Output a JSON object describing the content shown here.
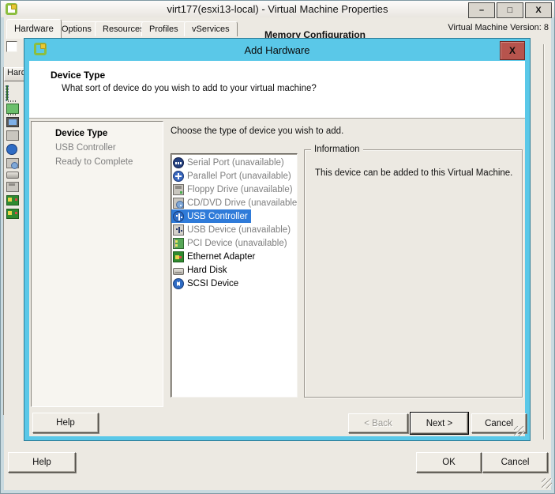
{
  "window": {
    "title": "virt177(esxi13-local) - Virtual Machine Properties",
    "controls": {
      "minimize": "–",
      "maximize": "□",
      "close": "X"
    },
    "tabs": [
      {
        "label": "Hardware",
        "active": true
      },
      {
        "label": "Options",
        "active": false
      },
      {
        "label": "Resources",
        "active": false
      },
      {
        "label": "Profiles",
        "active": false
      },
      {
        "label": "vServices",
        "active": false
      }
    ],
    "version_label": "Virtual Machine Version: 8",
    "clipped_heading": "Memory Configuration",
    "hardware_panel_header": "Hardware",
    "hardware_icons": [
      "memory",
      "cpu",
      "video-card",
      "vmci-device",
      "scsi-controller",
      "cd-dvd-drive",
      "hard-disk",
      "floppy-drive",
      "network-adapter-1",
      "network-adapter-2"
    ],
    "buttons": {
      "help": "Help",
      "ok": "OK",
      "cancel": "Cancel"
    }
  },
  "wizard": {
    "title": "Add Hardware",
    "close_label": "X",
    "header": {
      "title": "Device Type",
      "subtitle": "What sort of device do you wish to add to your virtual machine?"
    },
    "steps": [
      {
        "label": "Device Type",
        "state": "current"
      },
      {
        "label": "USB Controller",
        "state": "upcoming"
      },
      {
        "label": "Ready to Complete",
        "state": "upcoming"
      }
    ],
    "prompt": "Choose the type of device you wish to add.",
    "devices": [
      {
        "label": "Serial Port (unavailable)",
        "icon": "serial-port",
        "state": "unavailable"
      },
      {
        "label": "Parallel Port (unavailable)",
        "icon": "parallel-port",
        "state": "unavailable"
      },
      {
        "label": "Floppy Drive (unavailable)",
        "icon": "floppy-drive",
        "state": "unavailable"
      },
      {
        "label": "CD/DVD Drive (unavailable)",
        "icon": "cd-dvd-drive",
        "state": "unavailable"
      },
      {
        "label": "USB Controller",
        "icon": "usb-controller",
        "state": "selected"
      },
      {
        "label": "USB Device (unavailable)",
        "icon": "usb-device",
        "state": "unavailable"
      },
      {
        "label": "PCI Device (unavailable)",
        "icon": "pci-device",
        "state": "unavailable"
      },
      {
        "label": "Ethernet Adapter",
        "icon": "ethernet-adapter",
        "state": "available"
      },
      {
        "label": "Hard Disk",
        "icon": "hard-disk",
        "state": "available"
      },
      {
        "label": "SCSI Device",
        "icon": "scsi-device",
        "state": "available"
      }
    ],
    "info": {
      "title": "Information",
      "text": "This device can be added to this Virtual Machine."
    },
    "buttons": {
      "help": "Help",
      "back": "< Back",
      "next": "Next >",
      "cancel": "Cancel"
    },
    "back_enabled": false
  },
  "colors": {
    "accent_cyan": "#5AC8E8",
    "close_red": "#B7544D",
    "selection_blue": "#2F7BD9",
    "window_bg": "#ECE9E2"
  }
}
